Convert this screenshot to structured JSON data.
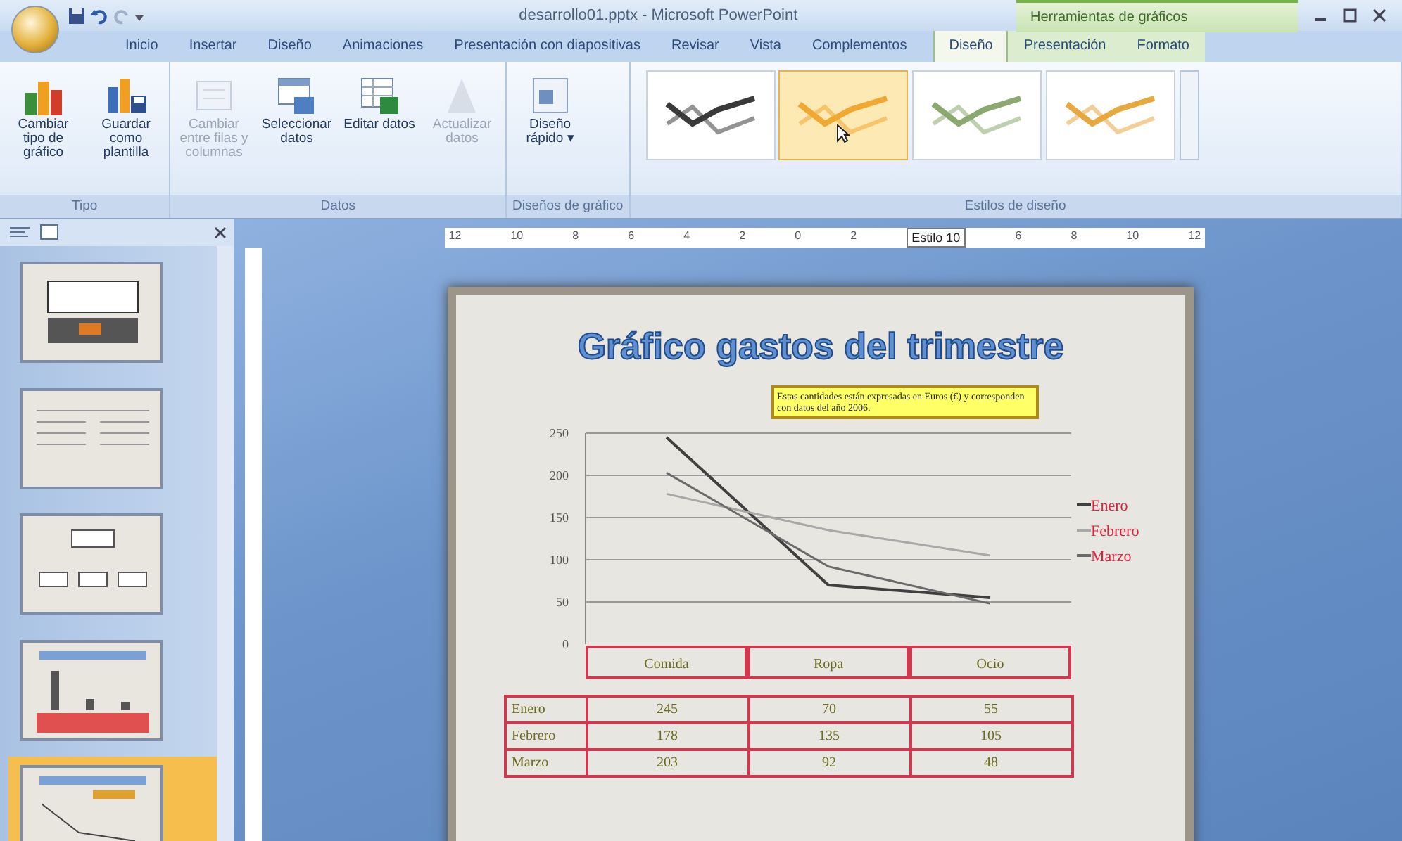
{
  "window": {
    "title": "desarrollo01.pptx - Microsoft PowerPoint",
    "context_group": "Herramientas de gráficos"
  },
  "tabs": [
    {
      "label": "Inicio",
      "selected": false,
      "contextual": false
    },
    {
      "label": "Insertar",
      "selected": false,
      "contextual": false
    },
    {
      "label": "Diseño",
      "selected": false,
      "contextual": false
    },
    {
      "label": "Animaciones",
      "selected": false,
      "contextual": false
    },
    {
      "label": "Presentación con diapositivas",
      "selected": false,
      "contextual": false
    },
    {
      "label": "Revisar",
      "selected": false,
      "contextual": false
    },
    {
      "label": "Vista",
      "selected": false,
      "contextual": false
    },
    {
      "label": "Complementos",
      "selected": false,
      "contextual": false
    },
    {
      "label": "Diseño",
      "selected": true,
      "contextual": true
    },
    {
      "label": "Presentación",
      "selected": false,
      "contextual": true
    },
    {
      "label": "Formato",
      "selected": false,
      "contextual": true
    }
  ],
  "ribbon_groups": [
    {
      "kind": "buttons",
      "label": "Tipo",
      "buttons": [
        {
          "label": "Cambiar tipo de gráfico",
          "disabled": false
        },
        {
          "label": "Guardar como plantilla",
          "disabled": false
        }
      ]
    },
    {
      "kind": "buttons",
      "label": "Datos",
      "buttons": [
        {
          "label": "Cambiar entre filas y columnas",
          "disabled": true
        },
        {
          "label": "Seleccionar datos",
          "disabled": false
        },
        {
          "label": "Editar datos",
          "disabled": false
        },
        {
          "label": "Actualizar datos",
          "disabled": true
        }
      ]
    },
    {
      "kind": "buttons",
      "label": "Diseños de gráfico",
      "buttons": [
        {
          "label": "Diseño rápido ▾",
          "disabled": false
        }
      ]
    },
    {
      "kind": "gallery",
      "label": "Estilos de diseño",
      "styles": [
        {
          "color": "#3a3a3a",
          "selected": false
        },
        {
          "color": "#f0a830",
          "selected": true
        },
        {
          "color": "#8aa870",
          "selected": false
        },
        {
          "color": "#e8a840",
          "selected": false
        }
      ]
    }
  ],
  "ruler": {
    "items": [
      {
        "kind": "number",
        "text": "12"
      },
      {
        "kind": "number",
        "text": "10"
      },
      {
        "kind": "number",
        "text": "8"
      },
      {
        "kind": "number",
        "text": "6"
      },
      {
        "kind": "number",
        "text": "4"
      },
      {
        "kind": "number",
        "text": "2"
      },
      {
        "kind": "number",
        "text": "0"
      },
      {
        "kind": "number",
        "text": "2"
      },
      {
        "kind": "tooltip",
        "text": "Estilo 10"
      },
      {
        "kind": "number",
        "text": "6"
      },
      {
        "kind": "number",
        "text": "8"
      },
      {
        "kind": "number",
        "text": "10"
      },
      {
        "kind": "number",
        "text": "12"
      }
    ]
  },
  "slides": [
    {
      "kind": "table",
      "selected": false
    },
    {
      "kind": "text",
      "selected": false
    },
    {
      "kind": "diagram",
      "selected": false
    },
    {
      "kind": "bar-chart",
      "selected": false
    },
    {
      "kind": "line-chart",
      "selected": true
    }
  ],
  "slide": {
    "title": "Gráfico gastos del trimestre",
    "note": "Estas cantidades están expresadas en Euros (€) y corresponden con datos del año 2006.",
    "chart_data": {
      "type": "line",
      "categories": [
        "Comida",
        "Ropa",
        "Ocio"
      ],
      "ylim": [
        0,
        250
      ],
      "yticks": [
        0,
        50,
        100,
        150,
        200,
        250
      ],
      "grid": true,
      "legend": true,
      "series": [
        {
          "name": "Enero",
          "color": "#404040",
          "values": [
            245,
            70,
            55
          ]
        },
        {
          "name": "Febrero",
          "color": "#a8a8a8",
          "values": [
            178,
            135,
            105
          ]
        },
        {
          "name": "Marzo",
          "color": "#6a6a6a",
          "values": [
            203,
            92,
            48
          ]
        }
      ]
    },
    "data_table": {
      "rows": [
        {
          "label": "Enero",
          "cells": [
            "245",
            "70",
            "55"
          ]
        },
        {
          "label": "Febrero",
          "cells": [
            "178",
            "135",
            "105"
          ]
        },
        {
          "label": "Marzo",
          "cells": [
            "203",
            "92",
            "48"
          ]
        }
      ]
    }
  }
}
